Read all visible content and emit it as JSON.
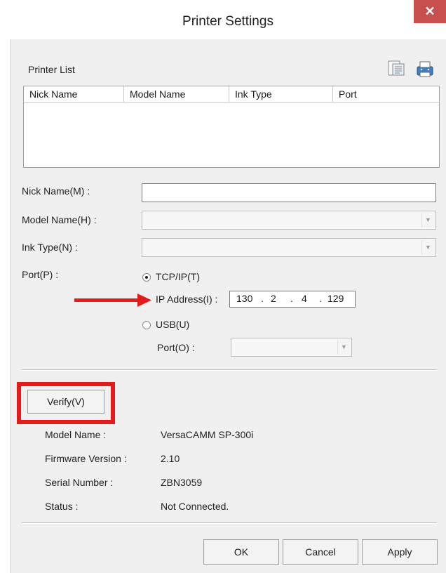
{
  "window": {
    "title": "Printer Settings",
    "close_glyph": "✕"
  },
  "printer_list": {
    "label": "Printer List",
    "columns": [
      "Nick Name",
      "Model Name",
      "Ink Type",
      "Port"
    ],
    "rows": []
  },
  "toolbar_icons": [
    "printer-properties-icon",
    "printer-network-icon"
  ],
  "fields": {
    "nick_name": {
      "label": "Nick Name(M) :",
      "value": ""
    },
    "model_name": {
      "label": "Model Name(H) :",
      "value": ""
    },
    "ink_type": {
      "label": "Ink Type(N) :",
      "value": ""
    }
  },
  "port": {
    "label": "Port(P) :",
    "tcpip_label": "TCP/IP(T)",
    "tcpip_selected": true,
    "ip_label": "IP Address(I) :",
    "ip_octets": [
      "130",
      "2",
      "4",
      "129"
    ],
    "usb_label": "USB(U)",
    "usb_selected": false,
    "usb_port_label": "Port(O) :",
    "usb_port_value": ""
  },
  "verify": {
    "button_label": "Verify(V)"
  },
  "info": {
    "model_name_label": "Model Name :",
    "model_name_value": "VersaCAMM SP-300i",
    "firmware_label": "Firmware Version :",
    "firmware_value": "2.10",
    "serial_label": "Serial Number :",
    "serial_value": "ZBN3059",
    "status_label": "Status :",
    "status_value": "Not Connected."
  },
  "buttons": {
    "ok": "OK",
    "cancel": "Cancel",
    "apply": "Apply"
  },
  "colors": {
    "highlight_red": "#e41b1b",
    "close_red": "#c74f4f",
    "dialog_bg": "#f0f0f0"
  }
}
